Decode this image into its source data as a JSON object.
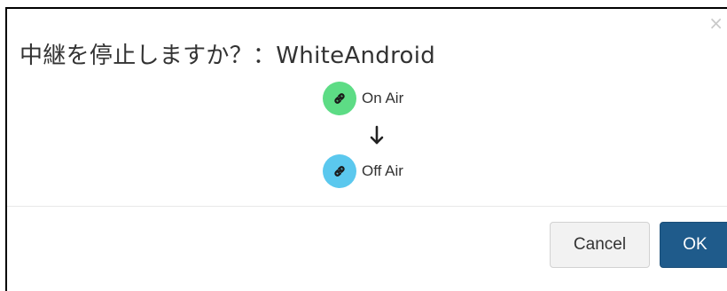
{
  "dialog": {
    "title": "中継を停止しますか？：WhiteAndroid",
    "close_glyph": "×",
    "from_status": {
      "label": "On Air",
      "icon": "link-icon",
      "color": "#5ddc85"
    },
    "to_status": {
      "label": "Off Air",
      "icon": "link-icon",
      "color": "#5bc8ee"
    },
    "arrow_icon": "arrow-down-icon",
    "buttons": {
      "cancel_label": "Cancel",
      "ok_label": "OK"
    },
    "colors": {
      "ok_button": "#1f5b8b",
      "cancel_button": "#f2f2f2"
    }
  }
}
